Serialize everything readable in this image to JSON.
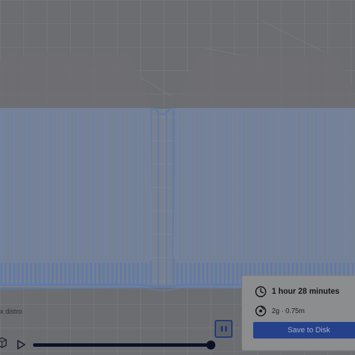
{
  "scene": {
    "object_label": "x distro"
  },
  "playback": {
    "progress": 1.0,
    "play_icon": "play-icon",
    "pause_icon": "pause-icon",
    "object_icon": "cube-icon"
  },
  "print_info": {
    "print_time": "1 hour 28 minutes",
    "material": "2g · 0.75m",
    "clock_icon": "clock-icon",
    "spool_icon": "spool-icon",
    "save_label": "Save to Disk"
  },
  "colors": {
    "accent": "#25418b",
    "toolpath": "#5f7aa9"
  }
}
